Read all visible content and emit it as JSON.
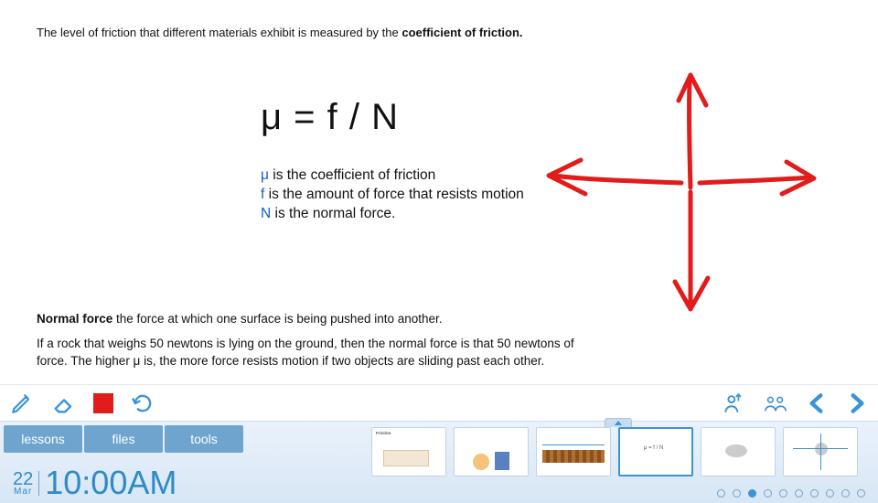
{
  "slide": {
    "intro_prefix": "The level of friction that different materials exhibit is measured by the ",
    "intro_bold": "coefficient of friction.",
    "formula": "μ = f / N",
    "legend": {
      "mu_sym": "μ",
      "mu_text": " is the coefficient of friction",
      "f_sym": "f",
      "f_text": " is the amount of force that resists motion",
      "n_sym": "N",
      "n_text": " is the normal force."
    },
    "normal_force_label": "Normal force",
    "normal_force_rest": " the force at which one surface is being pushed into another.",
    "example": "If a rock that weighs 50 newtons is lying on the ground, then the normal force is that 50 newtons of force. The higher μ is, the more force resists motion if two objects are sliding past each other."
  },
  "annotation_color": "#e21b1b",
  "toolbar": {
    "pencil": "pencil",
    "eraser": "eraser",
    "color": "color",
    "undo": "undo",
    "raise_hand": "raise-hand",
    "group": "group",
    "prev": "prev",
    "next": "next"
  },
  "menu": {
    "lessons": "lessons",
    "files": "files",
    "tools": "tools"
  },
  "clock": {
    "day": "22",
    "month": "Mar",
    "time": "10:00AM"
  },
  "thumbs": {
    "count": 6,
    "active_index": 3,
    "labels": [
      "Friction",
      "",
      "",
      "μ = f / N",
      "",
      ""
    ]
  },
  "dots": {
    "count": 10,
    "active_index": 2
  },
  "colors": {
    "brand_blue": "#3b93d6",
    "tab_blue": "#6fa4cf",
    "annotation_red": "#e21b1b"
  }
}
